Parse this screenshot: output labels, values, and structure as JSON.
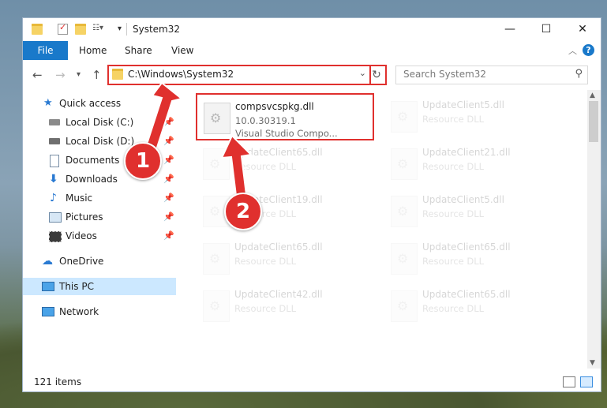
{
  "titlebar": {
    "title": "System32",
    "controls": {
      "minimize": "—",
      "maximize": "☐",
      "close": "✕"
    }
  },
  "ribbon": {
    "tabs": [
      {
        "label": "File"
      },
      {
        "label": "Home"
      },
      {
        "label": "Share"
      },
      {
        "label": "View"
      }
    ],
    "help": "?"
  },
  "address": {
    "path": "C:\\Windows\\System32",
    "search_placeholder": "Search System32"
  },
  "nav": {
    "items": [
      {
        "label": "Quick access",
        "icon": "star-icon"
      },
      {
        "label": "Local Disk (C:)",
        "icon": "drive-icon"
      },
      {
        "label": "Local Disk (D:)",
        "icon": "drive-icon"
      },
      {
        "label": "Documents",
        "icon": "documents-icon"
      },
      {
        "label": "Downloads",
        "icon": "downloads-icon"
      },
      {
        "label": "Music",
        "icon": "music-icon"
      },
      {
        "label": "Pictures",
        "icon": "pictures-icon"
      },
      {
        "label": "Videos",
        "icon": "videos-icon"
      },
      {
        "label": "OneDrive",
        "icon": "cloud-icon"
      },
      {
        "label": "This PC",
        "icon": "computer-icon"
      },
      {
        "label": "Network",
        "icon": "network-icon"
      }
    ]
  },
  "files": [
    {
      "name": "compsvcspkg.dll",
      "line1": "10.0.30319.1",
      "line2": "Visual Studio Compo..."
    },
    {
      "name": "UpdateClient5.dll",
      "line1": "Resource DLL",
      "line2": ""
    },
    {
      "name": "UpdateClient65.dll",
      "line1": "Resource DLL",
      "line2": ""
    },
    {
      "name": "UpdateClient21.dll",
      "line1": "Resource DLL",
      "line2": ""
    },
    {
      "name": "UpdateClient19.dll",
      "line1": "Resource DLL",
      "line2": ""
    },
    {
      "name": "UpdateClient5.dll",
      "line1": "Resource DLL",
      "line2": ""
    },
    {
      "name": "UpdateClient65.dll",
      "line1": "Resource DLL",
      "line2": ""
    },
    {
      "name": "UpdateClient65.dll",
      "line1": "Resource DLL",
      "line2": ""
    },
    {
      "name": "UpdateClient42.dll",
      "line1": "Resource DLL",
      "line2": ""
    },
    {
      "name": "UpdateClient65.dll",
      "line1": "Resource DLL",
      "line2": ""
    }
  ],
  "status": {
    "count": "121 items"
  },
  "callouts": {
    "one": "1",
    "two": "2"
  },
  "colors": {
    "accent": "#1979ca",
    "highlight": "#e0302e",
    "selection": "#cce8ff"
  }
}
